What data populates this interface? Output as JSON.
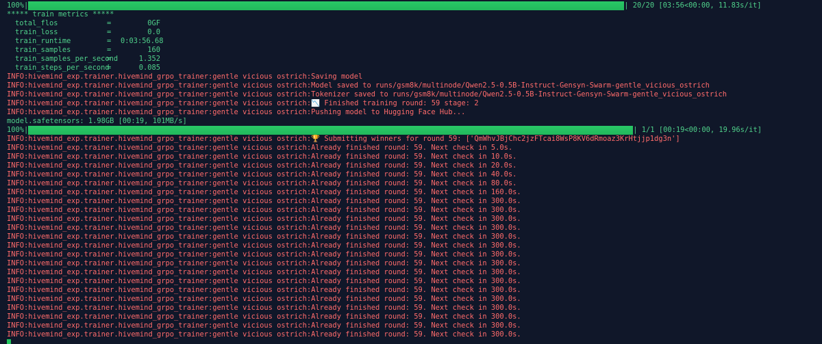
{
  "progress1": {
    "percent_label": "100%|",
    "progress_fraction": 1.0,
    "suffix": "| 20/20 [03:56<00:00, 11.83s/it]"
  },
  "metrics_header": "***** train metrics *****",
  "metrics": [
    {
      "key": "total_flos",
      "eq": "=",
      "value": "0GF"
    },
    {
      "key": "train_loss",
      "eq": "=",
      "value": "0.0"
    },
    {
      "key": "train_runtime",
      "eq": "=",
      "value": "0:03:56.68"
    },
    {
      "key": "train_samples",
      "eq": "=",
      "value": "160"
    },
    {
      "key": "train_samples_per_second",
      "eq": "=",
      "value": "1.352"
    },
    {
      "key": "train_steps_per_second",
      "eq": "=",
      "value": "0.085"
    }
  ],
  "info_prefix": "INFO:hivemind_exp.trainer.hivemind_grpo_trainer:gentle vicious ostrich:",
  "log_block_a": [
    "Saving model",
    "Model saved to runs/gsm8k/multinode/Qwen2.5-0.5B-Instruct-Gensyn-Swarm-gentle_vicious_ostrich",
    "Tokenizer saved to runs/gsm8k/multinode/Qwen2.5-0.5B-Instruct-Gensyn-Swarm-gentle_vicious_ostrich"
  ],
  "finished_line": {
    "icon": "📉",
    "icon_name": "chart-icon",
    "text": " Finished training round: 59 stage: 2"
  },
  "pushing_line": "Pushing model to Hugging Face Hub...",
  "safetensors_line": "model.safetensors: 1.98GB [00:19, 101MB/s]",
  "progress2": {
    "percent_label": "100%|",
    "progress_fraction": 1.0,
    "suffix": "| 1/1 [00:19<00:00, 19.96s/it]"
  },
  "submitting_line": {
    "icon": "🏆",
    "icon_name": "trophy-icon",
    "text": " Submitting winners for round 59: ['QmWhvJBjChc2jzFTcai8WsP8KV6dRmoaz3KrHtjjp1dg3n']"
  },
  "already_lines": [
    "Already finished round: 59. Next check in 5.0s.",
    "Already finished round: 59. Next check in 10.0s.",
    "Already finished round: 59. Next check in 20.0s.",
    "Already finished round: 59. Next check in 40.0s.",
    "Already finished round: 59. Next check in 80.0s.",
    "Already finished round: 59. Next check in 160.0s.",
    "Already finished round: 59. Next check in 300.0s.",
    "Already finished round: 59. Next check in 300.0s.",
    "Already finished round: 59. Next check in 300.0s.",
    "Already finished round: 59. Next check in 300.0s.",
    "Already finished round: 59. Next check in 300.0s.",
    "Already finished round: 59. Next check in 300.0s.",
    "Already finished round: 59. Next check in 300.0s.",
    "Already finished round: 59. Next check in 300.0s.",
    "Already finished round: 59. Next check in 300.0s.",
    "Already finished round: 59. Next check in 300.0s.",
    "Already finished round: 59. Next check in 300.0s.",
    "Already finished round: 59. Next check in 300.0s.",
    "Already finished round: 59. Next check in 300.0s.",
    "Already finished round: 59. Next check in 300.0s.",
    "Already finished round: 59. Next check in 300.0s.",
    "Already finished round: 59. Next check in 300.0s."
  ],
  "colors": {
    "background": "#101729",
    "green_text": "#4fd08a",
    "red_text": "#ff6b6b",
    "progress_fill": "#22c55e"
  }
}
